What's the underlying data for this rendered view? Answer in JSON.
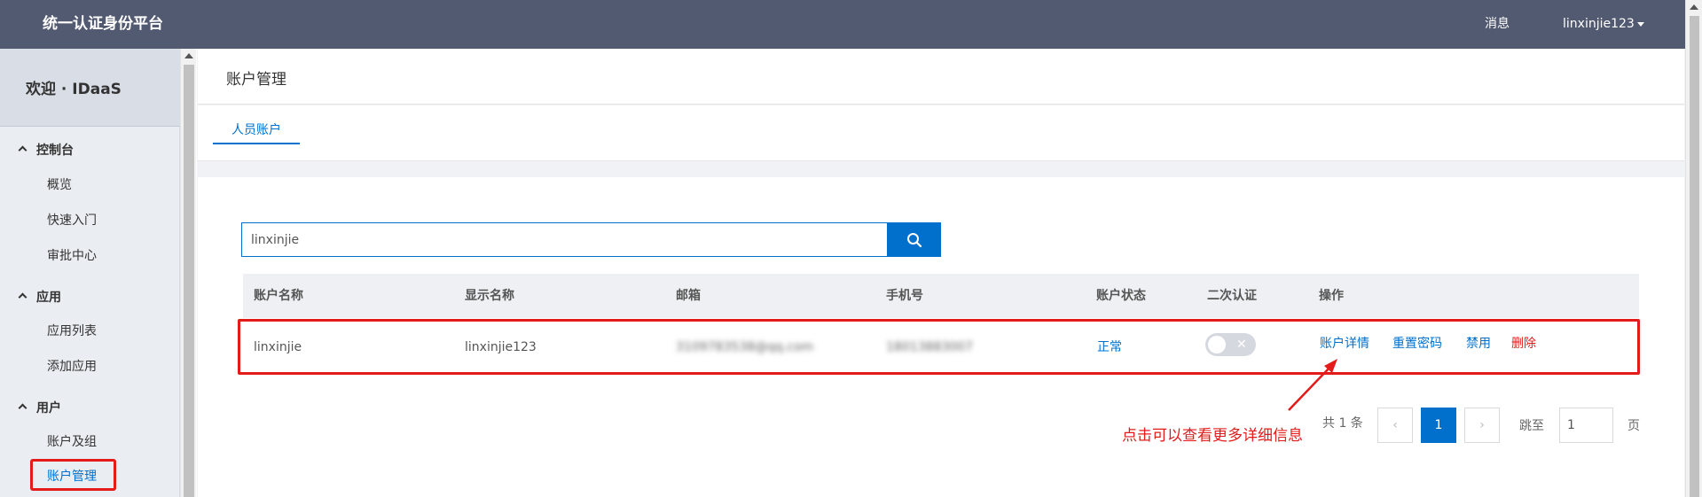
{
  "header": {
    "brand": "统一认证身份平台",
    "messages": "消息",
    "username": "linxinjie123"
  },
  "sidebar": {
    "welcome": "欢迎 · IDaaS",
    "sections": [
      {
        "title": "控制台",
        "items": [
          "概览",
          "快速入门",
          "审批中心"
        ]
      },
      {
        "title": "应用",
        "items": [
          "应用列表",
          "添加应用"
        ]
      },
      {
        "title": "用户",
        "items": [
          "账户及组",
          "账户管理"
        ]
      }
    ],
    "active_item": "账户管理"
  },
  "page": {
    "title": "账户管理",
    "tab": "人员账户"
  },
  "search": {
    "value": "linxinjie"
  },
  "table": {
    "headers": [
      "账户名称",
      "显示名称",
      "邮箱",
      "手机号",
      "账户状态",
      "二次认证",
      "操作"
    ],
    "row": {
      "account": "linxinjie",
      "display": "linxinjie123",
      "email": "3109783538@qq.com",
      "phone": "18013883007",
      "status": "正常",
      "actions": [
        "账户详情",
        "重置密码",
        "禁用",
        "删除"
      ]
    }
  },
  "annotation": "点击可以查看更多详细信息",
  "pagination": {
    "total": "共 1 条",
    "current": "1",
    "jump_label": "跳至",
    "jump_value": "1",
    "page_label": "页"
  },
  "colors": {
    "topbar": "#525a71",
    "primary": "#0070cc",
    "annotation": "#e31b1b"
  }
}
